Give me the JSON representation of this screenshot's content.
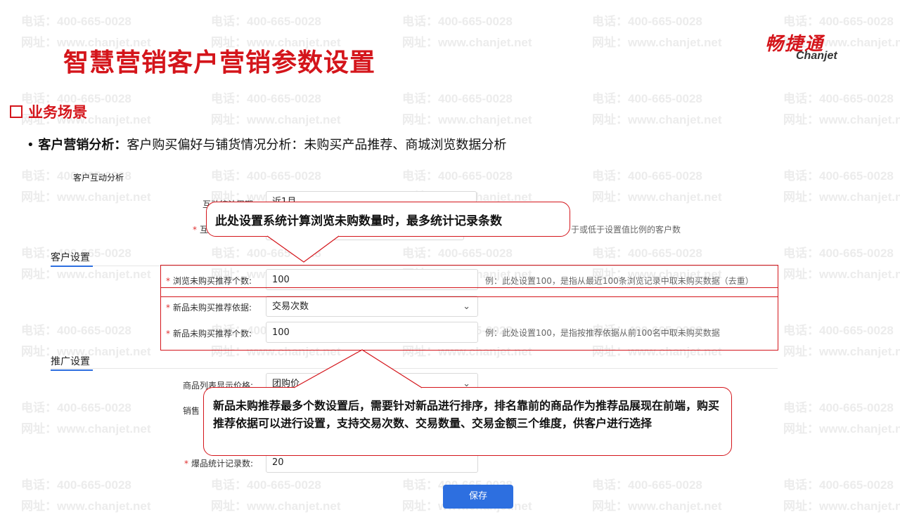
{
  "watermark": {
    "phone": "电话：400-665-0028",
    "site": "网址：www.chanjet.net"
  },
  "slide": {
    "title": "智慧营销客户营销参数设置",
    "section": "业务场景",
    "bullet_bold": "客户营销分析：",
    "bullet_text": "客户购买偏好与铺货情况分析：未购买产品推荐、商城浏览数据分析"
  },
  "logo": {
    "cn": "畅捷通",
    "en": "Chanjet"
  },
  "ui": {
    "interaction_title": "客户互动分析",
    "partial_label_1": "互动统计周期",
    "partial_value_1": "近1月",
    "partial_label_2": "互",
    "partial_hint_2": "于或低于设置值比例的客户数",
    "customer_tab": "客户设置",
    "promo_tab": "推广设置",
    "browse_label": "浏览未购买推荐个数:",
    "browse_value": "100",
    "browse_hint": "例：此处设置100，是指从最近100条浏览记录中取未购买数据（去重）",
    "basis_label": "新品未购买推荐依据:",
    "basis_value": "交易次数",
    "newcount_label": "新品未购买推荐个数:",
    "newcount_value": "100",
    "newcount_hint": "例：此处设置100，是指按推荐依据从前100名中取未购买数据",
    "price_label": "商品列表显示价格:",
    "price_value": "团购价",
    "sales_label": "销售",
    "hot_label": "爆品统计记录数:",
    "hot_value": "20",
    "button_label": "保存"
  },
  "callouts": {
    "top": "此处设置系统计算浏览未购数量时，最多统计记录条数",
    "bottom": "新品未购推荐最多个数设置后，需要针对新品进行排序，排名靠前的商品作为推荐品展现在前端，购买推荐依据可以进行设置，支持交易次数、交易数量、交易金额三个维度，供客户进行选择"
  },
  "colors": {
    "brand_red": "#d4151b",
    "accent_blue": "#2d6fe0"
  }
}
